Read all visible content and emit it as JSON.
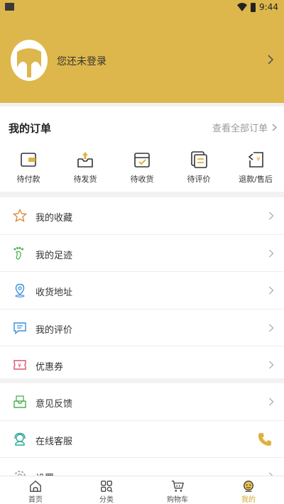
{
  "status": {
    "time": "9:44"
  },
  "profile": {
    "login_text": "您还未登录"
  },
  "orders": {
    "title": "我的订单",
    "view_all": "查看全部订单",
    "items": [
      {
        "label": "待付款",
        "icon": "wallet-icon"
      },
      {
        "label": "待发货",
        "icon": "box-upload-icon"
      },
      {
        "label": "待收货",
        "icon": "box-check-icon"
      },
      {
        "label": "待评价",
        "icon": "comment-doc-icon"
      },
      {
        "label": "退款/售后",
        "icon": "refund-icon"
      }
    ]
  },
  "menu_1": [
    {
      "label": "我的收藏",
      "icon": "star-icon"
    },
    {
      "label": "我的足迹",
      "icon": "footprint-icon"
    },
    {
      "label": "收货地址",
      "icon": "location-pin-icon"
    },
    {
      "label": "我的评价",
      "icon": "chat-icon"
    },
    {
      "label": "优惠券",
      "icon": "coupon-icon"
    }
  ],
  "menu_2": [
    {
      "label": "意见反馈",
      "icon": "feedback-mail-icon"
    },
    {
      "label": "在线客服",
      "icon": "headset-icon"
    },
    {
      "label": "设置",
      "icon": "gear-icon"
    }
  ],
  "tabbar": [
    {
      "label": "首页",
      "icon": "home-icon"
    },
    {
      "label": "分类",
      "icon": "category-icon"
    },
    {
      "label": "购物车",
      "icon": "cart-icon"
    },
    {
      "label": "我的",
      "icon": "profile-face-icon",
      "active": true
    }
  ],
  "colors": {
    "accent": "#ddb74b",
    "accent_text": "#d0a82e"
  }
}
